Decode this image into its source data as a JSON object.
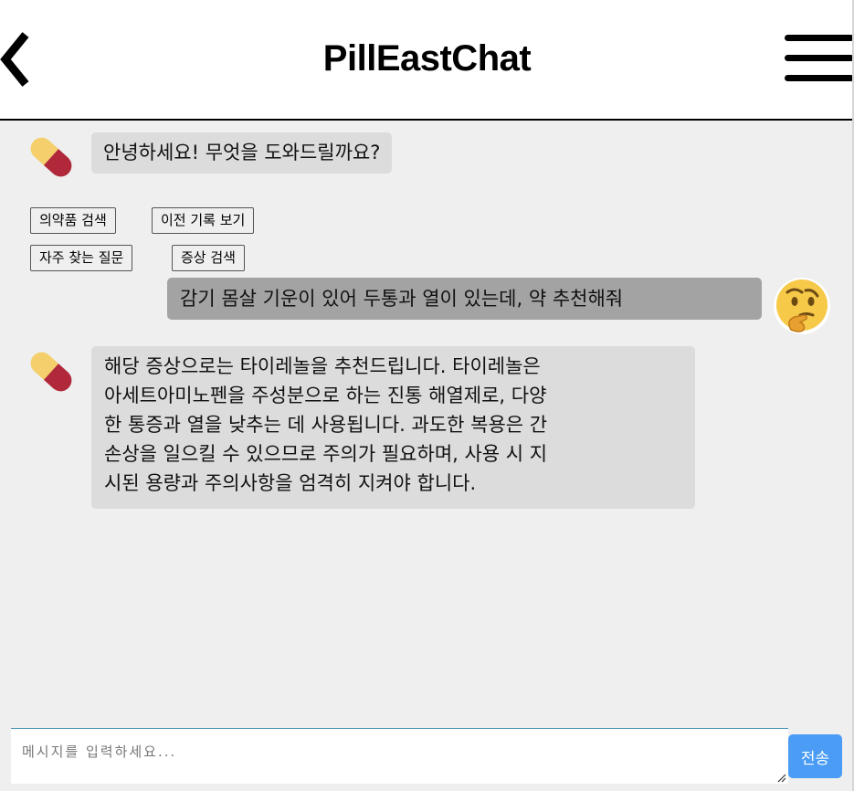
{
  "header": {
    "title": "PillEastChat",
    "back_icon": "chevron-left-icon",
    "menu_icon": "hamburger-menu-icon"
  },
  "messages": [
    {
      "sender": "bot",
      "avatar_icon": "pill-capsule-icon",
      "text": "안녕하세요! 무엇을 도와드릴까요?"
    },
    {
      "sender": "user",
      "avatar_icon": "thinking-face-emoji",
      "text": "감기 몸살 기운이 있어 두통과 열이 있는데, 약 추천해줘"
    },
    {
      "sender": "bot",
      "avatar_icon": "pill-capsule-icon",
      "lines": [
        "해당 증상으로는 타이레놀을 추천드립니다. 타이레놀은",
        "아세트아미노펜을 주성분으로 하는 진통 해열제로, 다양",
        "한 통증과 열을 낮추는 데 사용됩니다. 과도한 복용은 간",
        "손상을 일으킬 수 있으므로 주의가 필요하며, 사용 시 지",
        "시된 용량과 주의사항을 엄격히 지켜야 합니다."
      ]
    }
  ],
  "quick_replies": [
    "의약품 검색",
    "이전 기록 보기",
    "자주 찾는 질문",
    "증상 검색"
  ],
  "input": {
    "value": "",
    "placeholder": "메시지를 입력하세요..."
  },
  "send_label": "전송",
  "colors": {
    "accent": "#4a9cf5",
    "bot_bubble": "#dcdcdc",
    "user_bubble": "#a3a3a3",
    "background": "#efefef",
    "pill_yellow": "#f5cf6b",
    "pill_red": "#b0283a",
    "emoji_yellow": "#f7c948"
  }
}
